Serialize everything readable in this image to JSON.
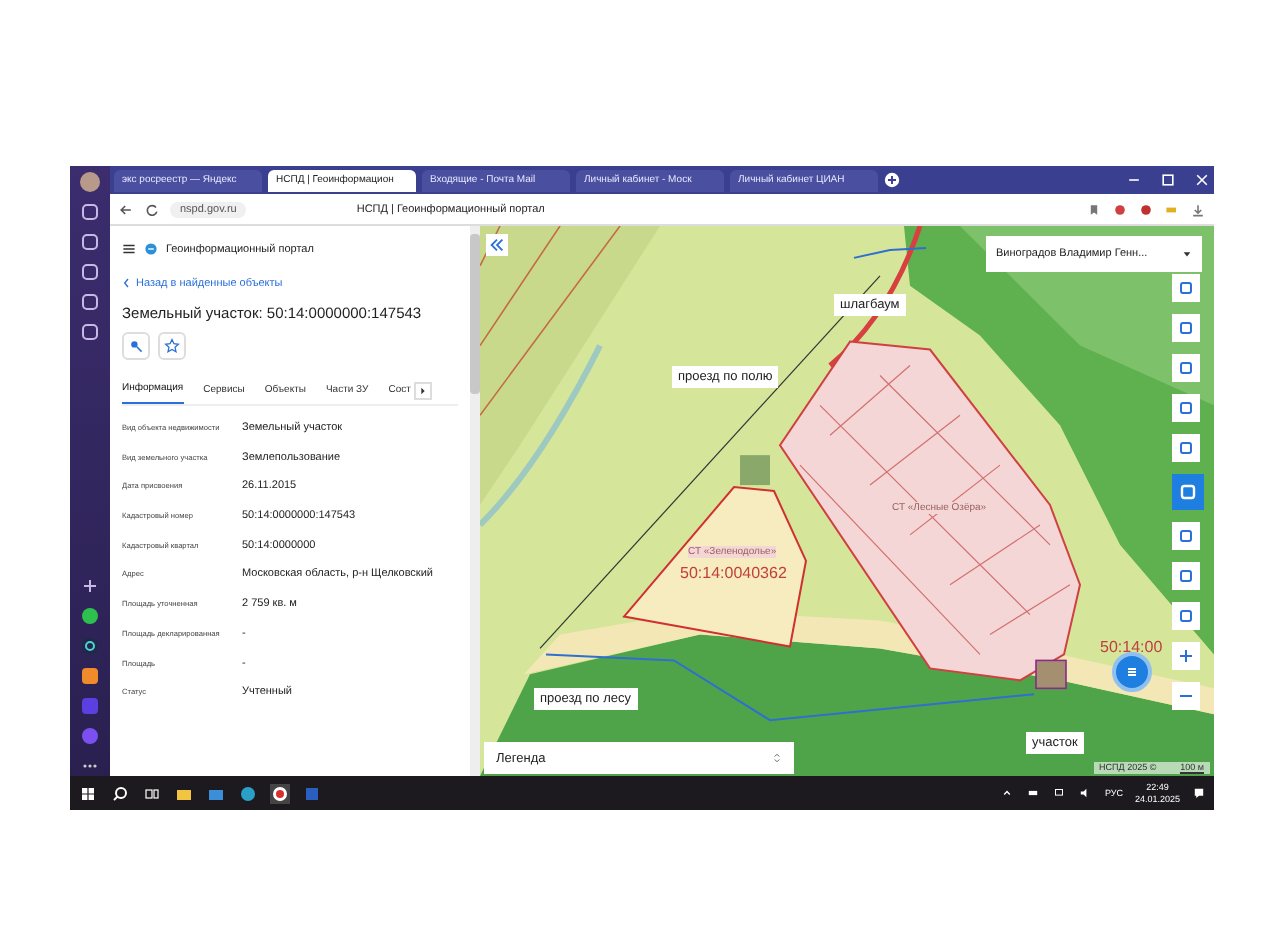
{
  "browser": {
    "tabs": [
      {
        "label": "экс росреестр — Яндекс",
        "selected": false
      },
      {
        "label": "НСПД | Геоинформацион",
        "selected": true
      },
      {
        "label": "Входящие - Почта Mail",
        "selected": false
      },
      {
        "label": "Личный кабинет - Моск",
        "selected": false
      },
      {
        "label": "Личный кабинет ЦИАН",
        "selected": false
      }
    ],
    "address": "nspd.gov.ru",
    "page_title": "НСПД | Геоинформационный портал"
  },
  "panel": {
    "portal_title": "Геоинформационный портал",
    "back_link": "Назад в найденные объекты",
    "heading": "Земельный участок: 50:14:0000000:147543",
    "tabs": [
      {
        "label": "Информация",
        "selected": true
      },
      {
        "label": "Сервисы",
        "selected": false
      },
      {
        "label": "Объекты",
        "selected": false
      },
      {
        "label": "Части ЗУ",
        "selected": false
      },
      {
        "label": "Сост",
        "selected": false
      }
    ],
    "fields": [
      {
        "label": "Вид объекта недвижимости",
        "value": "Земельный участок"
      },
      {
        "label": "Вид земельного участка",
        "value": "Землепользование"
      },
      {
        "label": "Дата присвоения",
        "value": "26.11.2015"
      },
      {
        "label": "Кадастровый номер",
        "value": "50:14:0000000:147543"
      },
      {
        "label": "Кадастровый квартал",
        "value": "50:14:0000000"
      },
      {
        "label": "Адрес",
        "value": "Московская область, р-н Щелковский"
      },
      {
        "label": "Площадь уточненная",
        "value": "2 759 кв. м"
      },
      {
        "label": "Площадь декларированная",
        "value": "-"
      },
      {
        "label": "Площадь",
        "value": "-"
      },
      {
        "label": "Статус",
        "value": "Учтенный"
      }
    ]
  },
  "map": {
    "user": "Виноградов Владимир Генн...",
    "annotations": [
      {
        "text": "шлагбаум"
      },
      {
        "text": "проезд по полю"
      },
      {
        "text": "проезд по лесу"
      },
      {
        "text": "участок"
      }
    ],
    "area_labels": [
      {
        "text": "СТ «Зеленодолье»",
        "kind": "name"
      },
      {
        "text": "50:14:0040362",
        "kind": "number"
      },
      {
        "text": "СТ «Лесные Озёра»",
        "kind": "name"
      },
      {
        "text": "50:14:00",
        "kind": "number"
      }
    ],
    "legend": "Легенда",
    "attribution": "НСПД 2025 ©",
    "scale": "100 м"
  },
  "taskbar": {
    "language": "РУС",
    "time": "22:49",
    "date": "24.01.2025"
  }
}
